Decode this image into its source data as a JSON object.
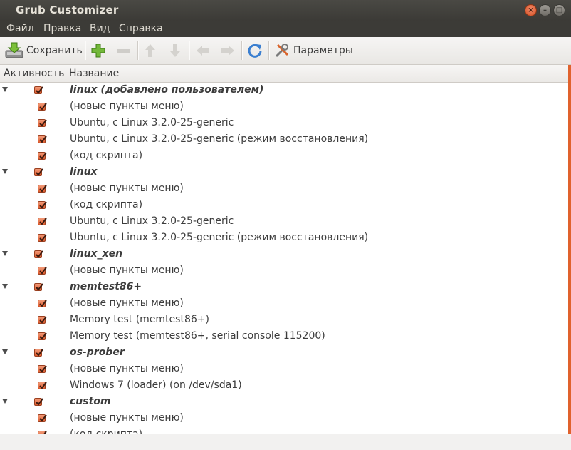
{
  "window": {
    "title": "Grub Customizer"
  },
  "menu": [
    "Файл",
    "Правка",
    "Вид",
    "Справка"
  ],
  "toolbar": {
    "save_label": "Сохранить",
    "settings_label": "Параметры"
  },
  "table": {
    "columns": [
      "Активность",
      "Название"
    ],
    "rows": [
      {
        "text": "linux (добавлено пользователем)",
        "group": true
      },
      {
        "text": "(новые пункты меню)",
        "group": false
      },
      {
        "text": "Ubuntu, с Linux 3.2.0-25-generic",
        "group": false
      },
      {
        "text": "Ubuntu, с Linux 3.2.0-25-generic (режим восстановления)",
        "group": false
      },
      {
        "text": "(код скрипта)",
        "group": false
      },
      {
        "text": "linux",
        "group": true
      },
      {
        "text": "(новые пункты меню)",
        "group": false
      },
      {
        "text": "(код скрипта)",
        "group": false
      },
      {
        "text": "Ubuntu, с Linux 3.2.0-25-generic",
        "group": false
      },
      {
        "text": "Ubuntu, с Linux 3.2.0-25-generic (режим восстановления)",
        "group": false
      },
      {
        "text": "linux_xen",
        "group": true
      },
      {
        "text": "(новые пункты меню)",
        "group": false
      },
      {
        "text": "memtest86+",
        "group": true
      },
      {
        "text": "(новые пункты меню)",
        "group": false
      },
      {
        "text": "Memory test (memtest86+)",
        "group": false
      },
      {
        "text": "Memory test (memtest86+, serial console 115200)",
        "group": false
      },
      {
        "text": "os-prober",
        "group": true
      },
      {
        "text": "(новые пункты меню)",
        "group": false
      },
      {
        "text": "Windows 7 (loader) (on /dev/sda1)",
        "group": false
      },
      {
        "text": "custom",
        "group": true
      },
      {
        "text": "(новые пункты меню)",
        "group": false
      },
      {
        "text": "(код скрипта)",
        "group": false
      }
    ]
  },
  "colors": {
    "accent": "#dd5a2c",
    "titlebar": "#3c3b37"
  }
}
